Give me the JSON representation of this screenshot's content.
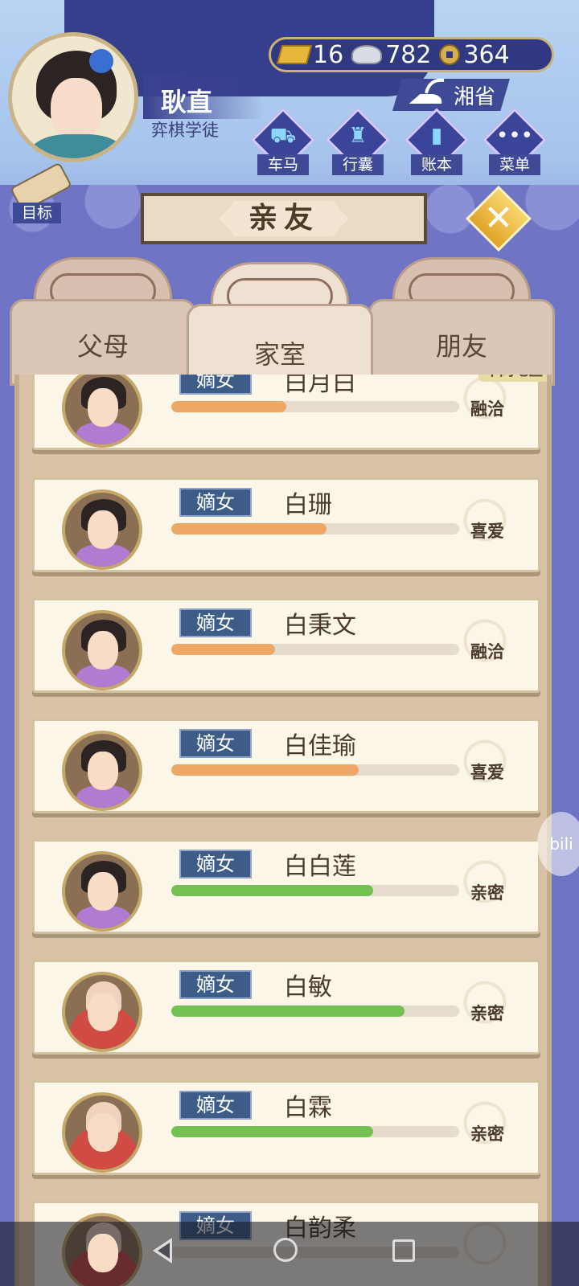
{
  "player": {
    "name": "耿直",
    "title": "弈棋学徒"
  },
  "currency": {
    "gold": "16",
    "silver": "782",
    "copper": "364"
  },
  "location": "湘省",
  "menu": [
    {
      "label": "车马",
      "icon": "carriage-icon"
    },
    {
      "label": "行囊",
      "icon": "bag-icon"
    },
    {
      "label": "账本",
      "icon": "ledger-icon"
    },
    {
      "label": "菜单",
      "icon": "more-icon"
    }
  ],
  "goal_label": "目标",
  "page_title": "亲友",
  "tabs": [
    {
      "label": "父母",
      "active": false
    },
    {
      "label": "家室",
      "active": true
    },
    {
      "label": "朋友",
      "active": false
    }
  ],
  "relatives": [
    {
      "tag": "嫡女",
      "name": "白月白",
      "status": "融洽",
      "affinity": 0.4,
      "bar_color": "#efa765",
      "region": "不同地区",
      "portrait": "girl"
    },
    {
      "tag": "嫡女",
      "name": "白珊",
      "status": "喜爱",
      "affinity": 0.54,
      "bar_color": "#efa765",
      "region": "",
      "portrait": "girl"
    },
    {
      "tag": "嫡女",
      "name": "白秉文",
      "status": "融洽",
      "affinity": 0.36,
      "bar_color": "#efa765",
      "region": "",
      "portrait": "girl"
    },
    {
      "tag": "嫡女",
      "name": "白佳瑜",
      "status": "喜爱",
      "affinity": 0.65,
      "bar_color": "#efa765",
      "region": "",
      "portrait": "girl"
    },
    {
      "tag": "嫡女",
      "name": "白白莲",
      "status": "亲密",
      "affinity": 0.7,
      "bar_color": "#72c151",
      "region": "",
      "portrait": "girl"
    },
    {
      "tag": "嫡女",
      "name": "白敏",
      "status": "亲密",
      "affinity": 0.81,
      "bar_color": "#72c151",
      "region": "",
      "portrait": "baby"
    },
    {
      "tag": "嫡女",
      "name": "白霖",
      "status": "亲密",
      "affinity": 0.7,
      "bar_color": "#72c151",
      "region": "",
      "portrait": "baby"
    },
    {
      "tag": "嫡女",
      "name": "白韵柔",
      "status": "",
      "affinity": 0.0,
      "bar_color": "#72c151",
      "region": "",
      "portrait": "baby"
    }
  ],
  "watermark": "bili"
}
